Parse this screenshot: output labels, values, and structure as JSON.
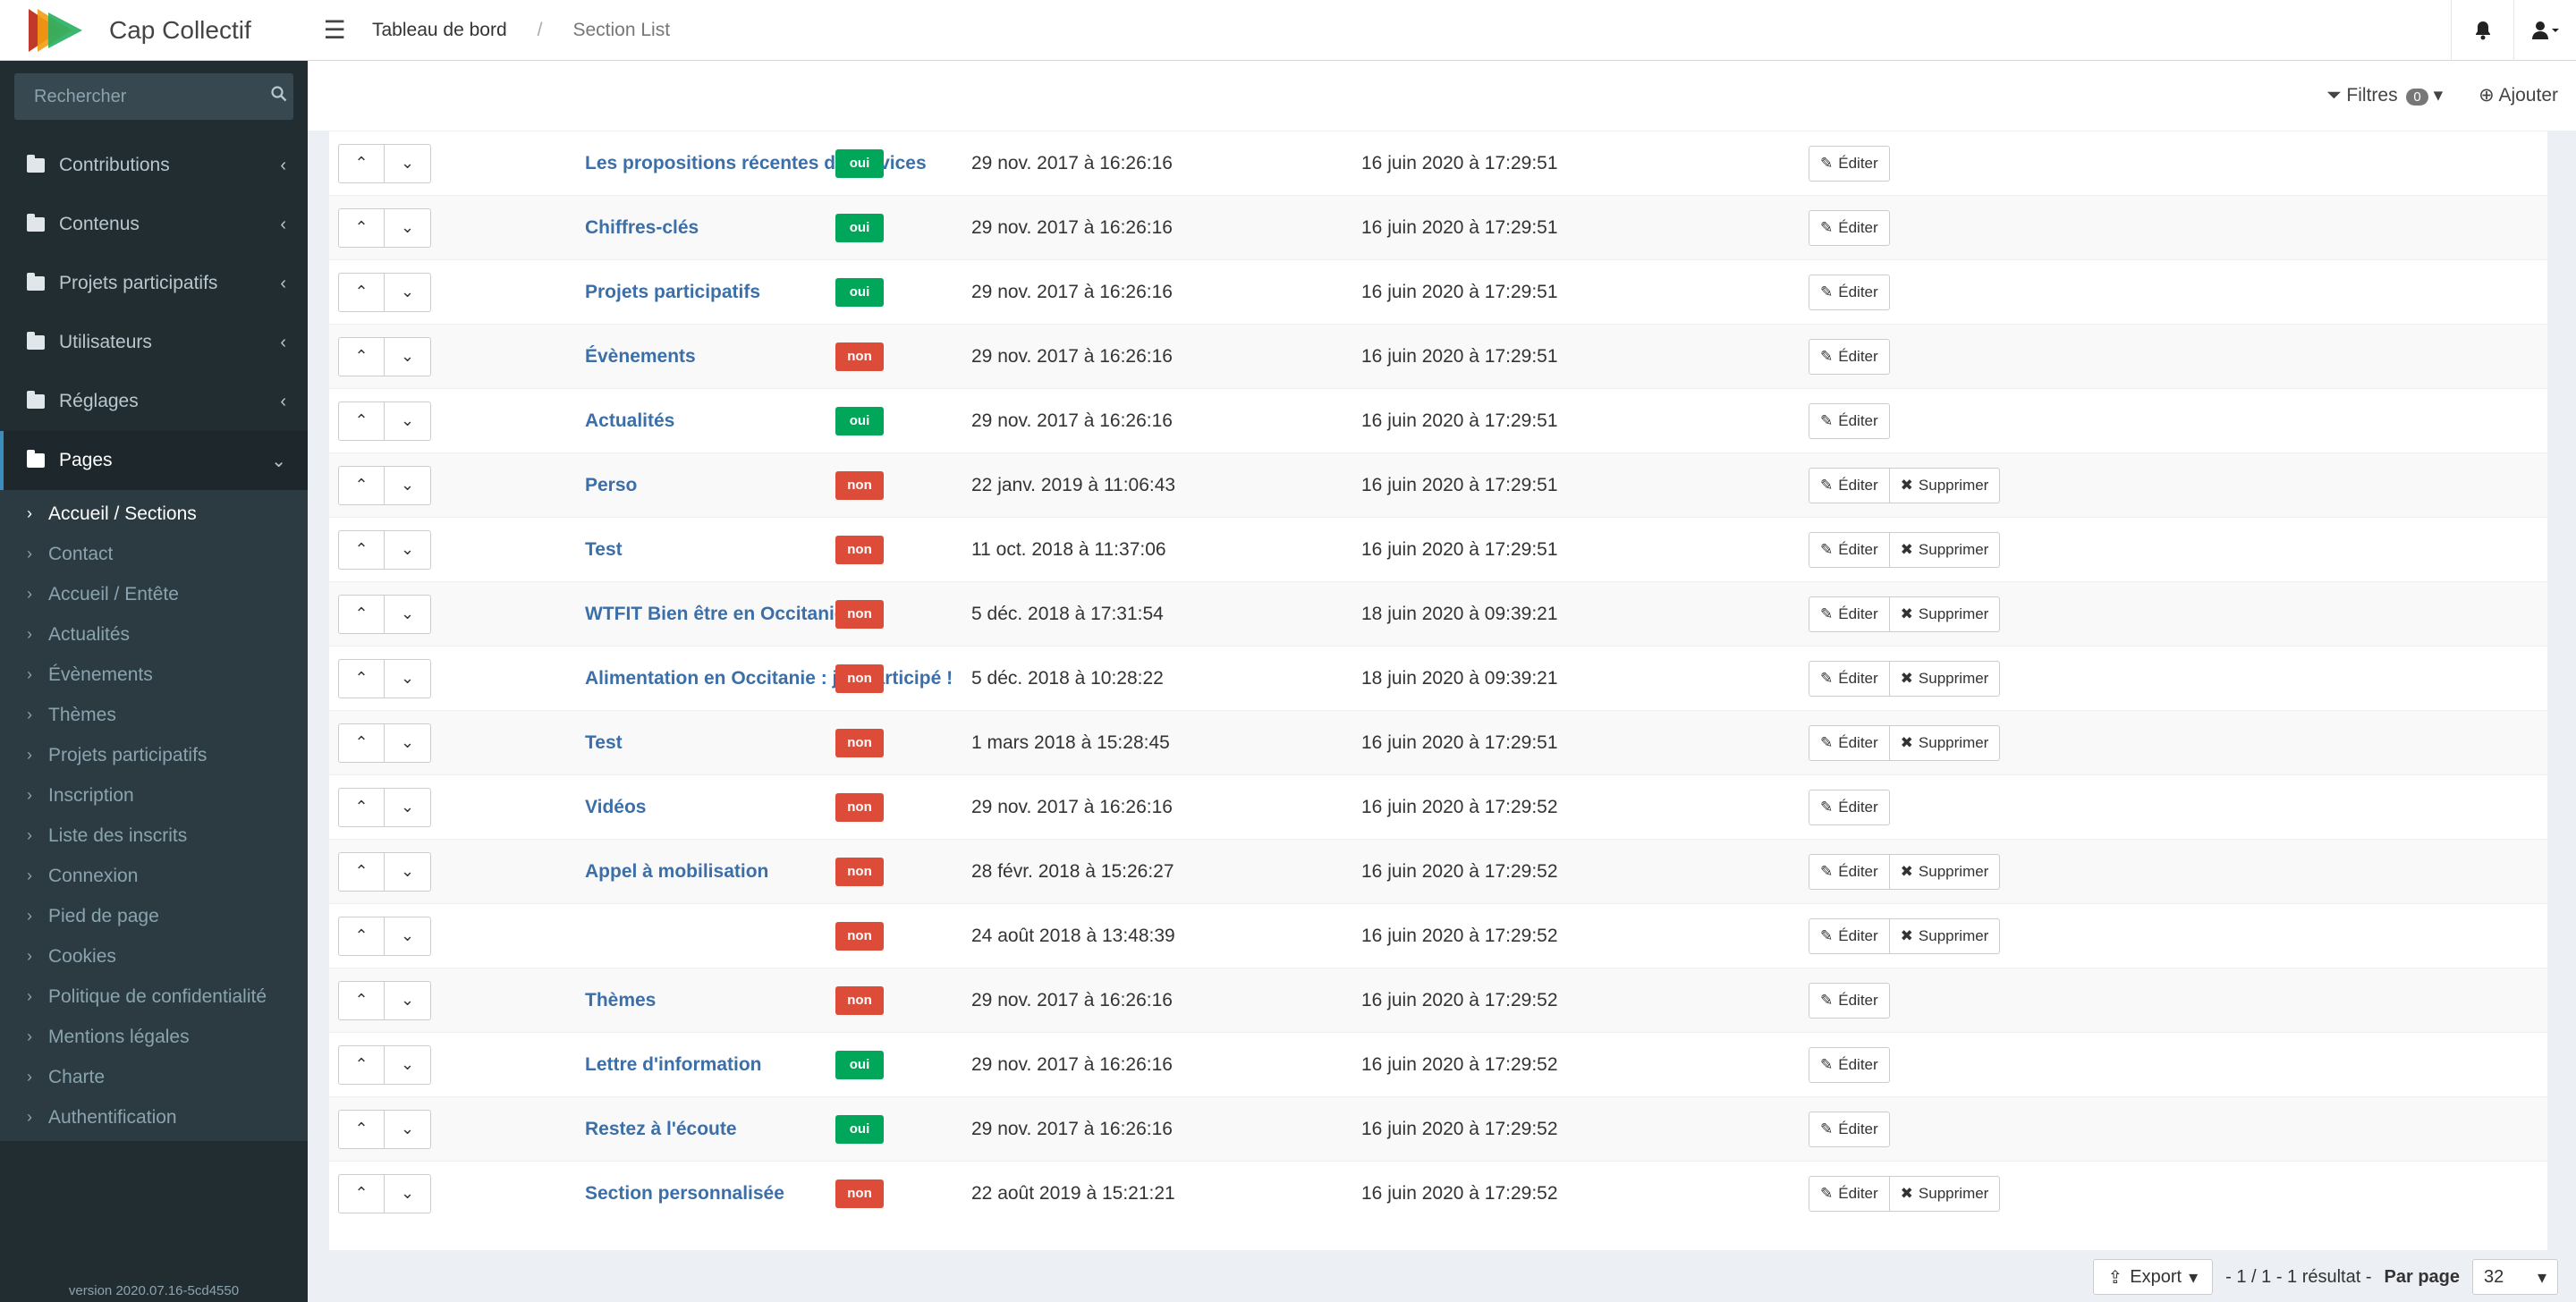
{
  "brand": {
    "name": "Cap Collectif"
  },
  "breadcrumb": [
    "Tableau de bord",
    "/",
    "Section List"
  ],
  "sidebar": {
    "search_placeholder": "Rechercher",
    "menu": [
      {
        "label": "Contributions",
        "expanded": false
      },
      {
        "label": "Contenus",
        "expanded": false
      },
      {
        "label": "Projets participatifs",
        "expanded": false
      },
      {
        "label": "Utilisateurs",
        "expanded": false
      },
      {
        "label": "Réglages",
        "expanded": false
      },
      {
        "label": "Pages",
        "expanded": true
      }
    ],
    "pages_submenu": [
      "Accueil / Sections",
      "Contact",
      "Accueil / Entête",
      "Actualités",
      "Évènements",
      "Thèmes",
      "Projets participatifs",
      "Inscription",
      "Liste des inscrits",
      "Connexion",
      "Pied de page",
      "Cookies",
      "Politique de confidentialité",
      "Mentions légales",
      "Charte",
      "Authentification"
    ],
    "version": "version 2020.07.16-5cd4550"
  },
  "toolbar": {
    "filters_label": "Filtres",
    "filters_count": "0",
    "add_label": "Ajouter"
  },
  "rows": [
    {
      "title": "Les propositions récentes de services",
      "enabled": "oui",
      "created": "29 nov. 2017 à 16:26:16",
      "updated": "16 juin 2020 à 17:29:51",
      "deletable": false
    },
    {
      "title": "Chiffres-clés",
      "enabled": "oui",
      "created": "29 nov. 2017 à 16:26:16",
      "updated": "16 juin 2020 à 17:29:51",
      "deletable": false
    },
    {
      "title": "Projets participatifs",
      "enabled": "oui",
      "created": "29 nov. 2017 à 16:26:16",
      "updated": "16 juin 2020 à 17:29:51",
      "deletable": false
    },
    {
      "title": "Évènements",
      "enabled": "non",
      "created": "29 nov. 2017 à 16:26:16",
      "updated": "16 juin 2020 à 17:29:51",
      "deletable": false
    },
    {
      "title": "Actualités",
      "enabled": "oui",
      "created": "29 nov. 2017 à 16:26:16",
      "updated": "16 juin 2020 à 17:29:51",
      "deletable": false
    },
    {
      "title": "Perso",
      "enabled": "non",
      "created": "22 janv. 2019 à 11:06:43",
      "updated": "16 juin 2020 à 17:29:51",
      "deletable": true
    },
    {
      "title": "Test",
      "enabled": "non",
      "created": "11 oct. 2018 à 11:37:06",
      "updated": "16 juin 2020 à 17:29:51",
      "deletable": true
    },
    {
      "title": "WTFIT Bien être en Occitanie",
      "enabled": "non",
      "created": "5 déc. 2018 à 17:31:54",
      "updated": "18 juin 2020 à 09:39:21",
      "deletable": true
    },
    {
      "title": "Alimentation en Occitanie : j'ai participé !",
      "enabled": "non",
      "created": "5 déc. 2018 à 10:28:22",
      "updated": "18 juin 2020 à 09:39:21",
      "deletable": true
    },
    {
      "title": "Test",
      "enabled": "non",
      "created": "1 mars 2018 à 15:28:45",
      "updated": "16 juin 2020 à 17:29:51",
      "deletable": true
    },
    {
      "title": "Vidéos",
      "enabled": "non",
      "created": "29 nov. 2017 à 16:26:16",
      "updated": "16 juin 2020 à 17:29:52",
      "deletable": false
    },
    {
      "title": "Appel à mobilisation",
      "enabled": "non",
      "created": "28 févr. 2018 à 15:26:27",
      "updated": "16 juin 2020 à 17:29:52",
      "deletable": true
    },
    {
      "title": "",
      "enabled": "non",
      "created": "24 août 2018 à 13:48:39",
      "updated": "16 juin 2020 à 17:29:52",
      "deletable": true
    },
    {
      "title": "Thèmes",
      "enabled": "non",
      "created": "29 nov. 2017 à 16:26:16",
      "updated": "16 juin 2020 à 17:29:52",
      "deletable": false
    },
    {
      "title": "Lettre d'information",
      "enabled": "oui",
      "created": "29 nov. 2017 à 16:26:16",
      "updated": "16 juin 2020 à 17:29:52",
      "deletable": false
    },
    {
      "title": "Restez à l'écoute",
      "enabled": "oui",
      "created": "29 nov. 2017 à 16:26:16",
      "updated": "16 juin 2020 à 17:29:52",
      "deletable": false
    },
    {
      "title": "Section personnalisée",
      "enabled": "non",
      "created": "22 août 2019 à 15:21:21",
      "updated": "16 juin 2020 à 17:29:52",
      "deletable": true
    }
  ],
  "labels": {
    "edit": "Éditer",
    "delete": "Supprimer"
  },
  "footer": {
    "export": "Export",
    "pagination": "- 1 / 1 - 1 résultat -",
    "per_page_label": "Par page",
    "per_page_value": "32"
  },
  "colors": {
    "oui": "#00a65a",
    "non": "#dd4b39",
    "link": "#3c6fa8",
    "sidebar": "#222d32"
  }
}
